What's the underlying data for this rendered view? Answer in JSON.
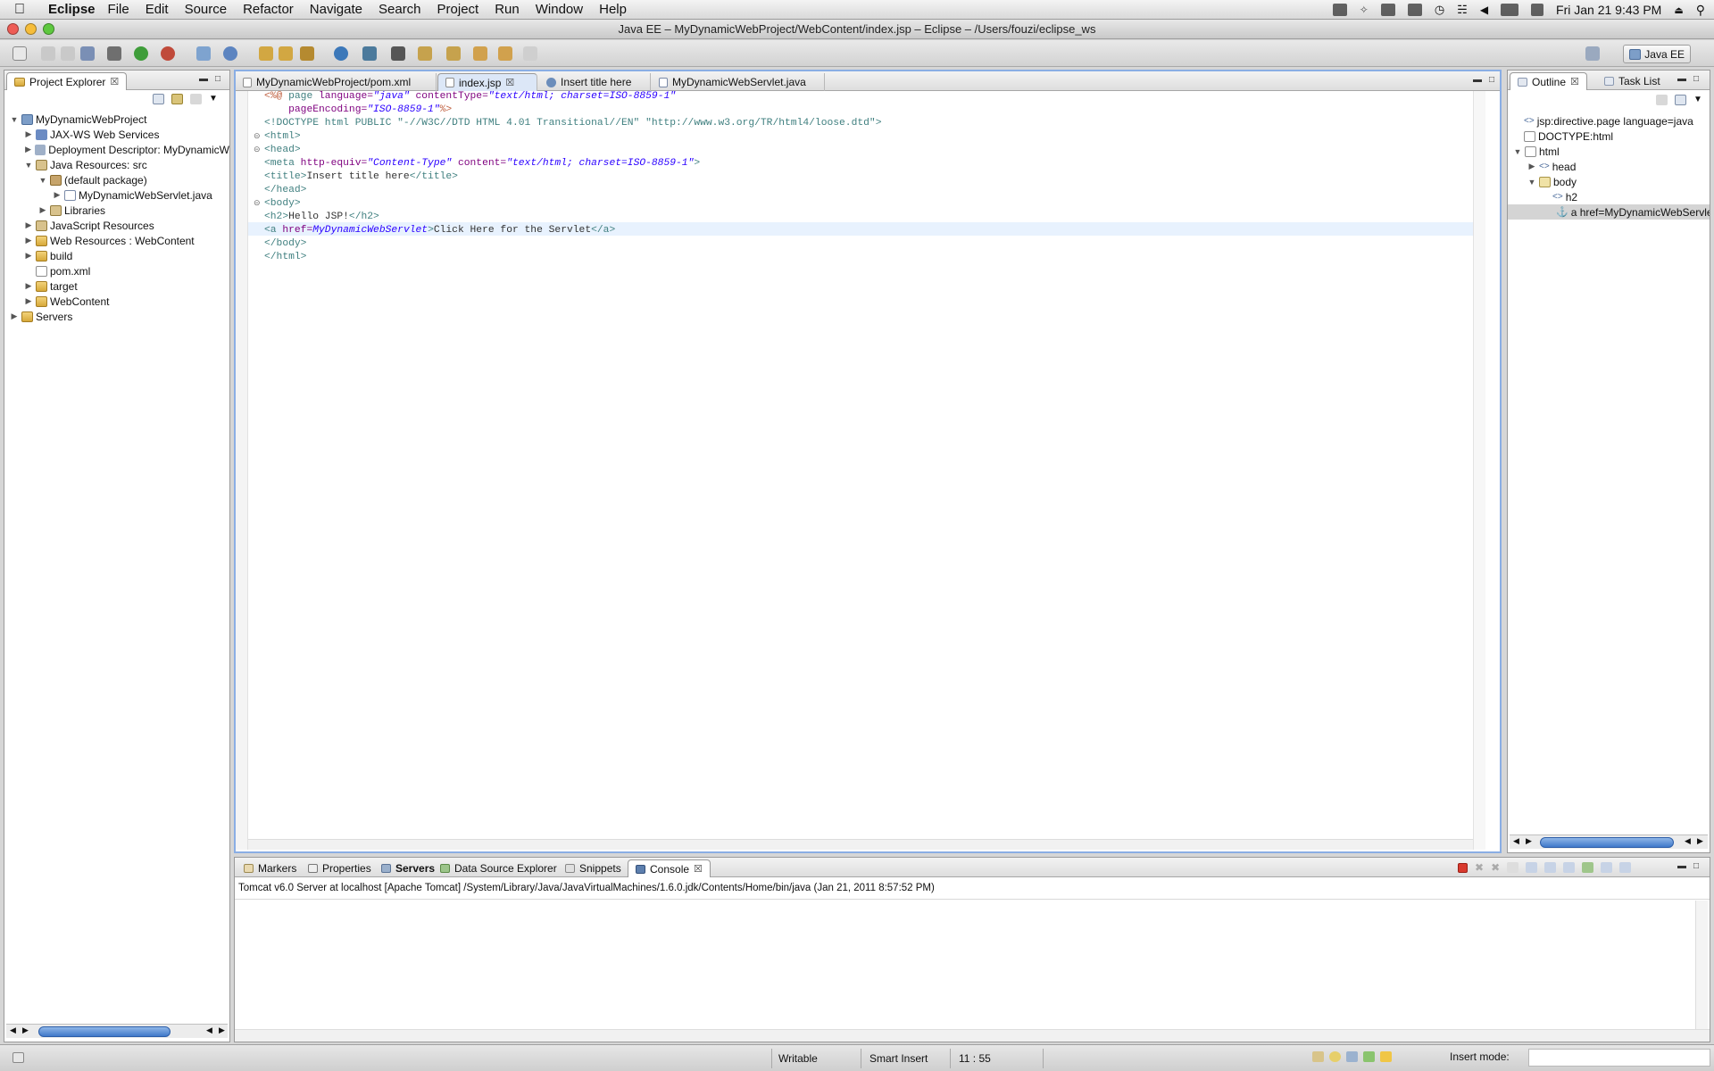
{
  "menubar": {
    "apple": "",
    "app": "Eclipse",
    "items": [
      "File",
      "Edit",
      "Source",
      "Refactor",
      "Navigate",
      "Search",
      "Project",
      "Run",
      "Window",
      "Help"
    ],
    "clock": "Fri Jan 21  9:43 PM"
  },
  "window": {
    "title": "Java EE – MyDynamicWebProject/WebContent/index.jsp – Eclipse – /Users/fouzi/eclipse_ws"
  },
  "toolbar": {
    "perspective": "Java EE"
  },
  "project_explorer": {
    "tab": "Project Explorer",
    "items": [
      {
        "label": "MyDynamicWebProject",
        "twisty": "▼",
        "icon": "project-icon"
      },
      {
        "label": "JAX-WS Web Services",
        "twisty": "▶",
        "icon": "webservices-icon"
      },
      {
        "label": "Deployment Descriptor: MyDynamicW",
        "twisty": "▶",
        "icon": "descriptor-icon"
      },
      {
        "label": "Java Resources: src",
        "twisty": "▼",
        "icon": "java-resources-icon"
      },
      {
        "label": "(default package)",
        "twisty": "▼",
        "icon": "package-icon"
      },
      {
        "label": "MyDynamicWebServlet.java",
        "twisty": "▶",
        "icon": "java-file-icon"
      },
      {
        "label": "Libraries",
        "twisty": "▶",
        "icon": "library-icon"
      },
      {
        "label": "JavaScript Resources",
        "twisty": "▶",
        "icon": "javascript-icon"
      },
      {
        "label": "Web Resources : WebContent",
        "twisty": "▶",
        "icon": "web-resources-icon"
      },
      {
        "label": "build",
        "twisty": "▶",
        "icon": "folder-icon"
      },
      {
        "label": "pom.xml",
        "twisty": "",
        "icon": "maven-file-icon"
      },
      {
        "label": "target",
        "twisty": "▶",
        "icon": "folder-icon"
      },
      {
        "label": "WebContent",
        "twisty": "▶",
        "icon": "folder-icon"
      },
      {
        "label": "Servers",
        "twisty": "▶",
        "icon": "folder-icon"
      }
    ]
  },
  "editor": {
    "tabs": [
      {
        "label": "MyDynamicWebProject/pom.xml"
      },
      {
        "label": "index.jsp",
        "active": true
      },
      {
        "label": "Insert title here"
      },
      {
        "label": "MyDynamicWebServlet.java"
      }
    ],
    "lines": {
      "l1a": "<%@",
      "l1b": " page ",
      "l1c": "language=",
      "l1d": "\"java\"",
      "l1e": " contentType=",
      "l1f": "\"text/html; charset=ISO-8859-1\"",
      "l2a": "    pageEncoding=",
      "l2b": "\"ISO-8859-1\"",
      "l2c": "%>",
      "l3": "<!DOCTYPE html PUBLIC \"-//W3C//DTD HTML 4.01 Transitional//EN\" \"http://www.w3.org/TR/html4/loose.dtd\">",
      "l4": "<html>",
      "l5": "<head>",
      "l6a": "<meta",
      "l6b": " http-equiv=",
      "l6c": "\"Content-Type\"",
      "l6d": " content=",
      "l6e": "\"text/html; charset=ISO-8859-1\"",
      "l6f": ">",
      "l7a": "<title>",
      "l7b": "Insert title here",
      "l7c": "</title>",
      "l8": "</head>",
      "l9": "<body>",
      "l10a": "<h2>",
      "l10b": "Hello JSP!",
      "l10c": "</h2>",
      "l11a": "<a",
      "l11b": " href=",
      "l11c": "MyDynamicWebServlet",
      "l11d": ">",
      "l11e": "Click Here for the Servlet",
      "l11f": "</a>",
      "l12": "</body>",
      "l13": "</html>"
    }
  },
  "outline": {
    "tabs": [
      "Outline",
      "Task List"
    ],
    "items": [
      {
        "label": "jsp:directive.page language=java",
        "twisty": ""
      },
      {
        "label": "DOCTYPE:html",
        "twisty": ""
      },
      {
        "label": "html",
        "twisty": "▼"
      },
      {
        "label": "head",
        "twisty": "▶"
      },
      {
        "label": "body",
        "twisty": "▼"
      },
      {
        "label": "h2",
        "twisty": ""
      },
      {
        "label": "a href=MyDynamicWebServle",
        "twisty": ""
      }
    ]
  },
  "bottom": {
    "tabs": [
      {
        "label": "Markers"
      },
      {
        "label": "Properties"
      },
      {
        "label": "Servers"
      },
      {
        "label": "Data Source Explorer"
      },
      {
        "label": "Snippets"
      },
      {
        "label": "Console",
        "active": true
      }
    ],
    "console_header": "Tomcat v6.0 Server at localhost [Apache Tomcat] /System/Library/Java/JavaVirtualMachines/1.6.0.jdk/Contents/Home/bin/java (Jan 21, 2011 8:57:52 PM)"
  },
  "status": {
    "writable": "Writable",
    "insert": "Smart Insert",
    "position": "11 : 55",
    "insert_mode": "Insert mode:"
  },
  "colors": {
    "tag": "#3f7f7f",
    "attr": "#7f007f",
    "string": "#2a00ff",
    "jsp": "#bf5f3f",
    "selection": "#dce7f7"
  }
}
